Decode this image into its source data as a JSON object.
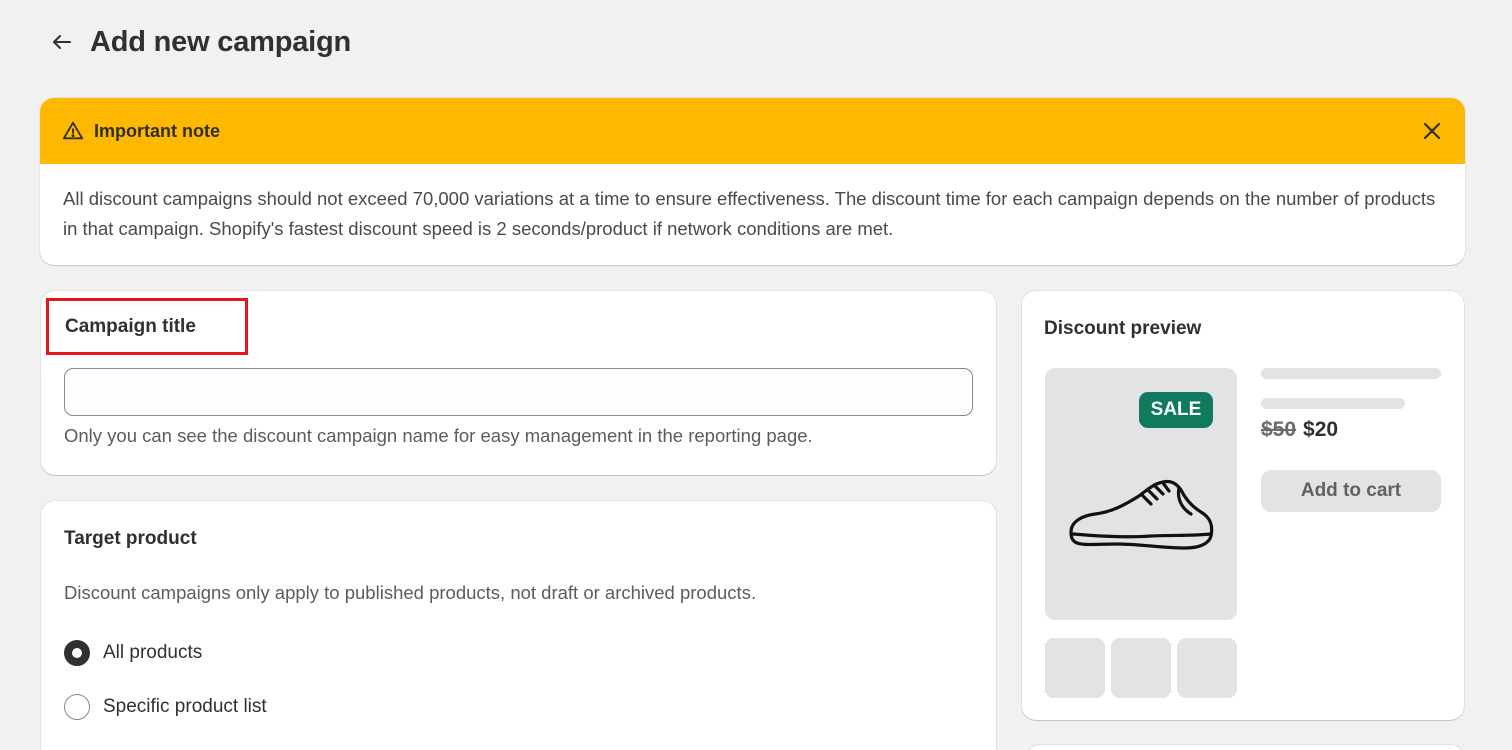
{
  "header": {
    "title": "Add new campaign",
    "back_icon": "arrow-left-icon"
  },
  "banner": {
    "title": "Important note",
    "icon": "warning-icon",
    "close_icon": "close-icon",
    "body": "All discount campaigns should not exceed 70,000 variations at a time to ensure effectiveness. The discount time for each campaign depends on the number of products in that campaign. Shopify's fastest discount speed is 2 seconds/product if network conditions are met.",
    "color": "#ffb800"
  },
  "campaign": {
    "title": "Campaign title",
    "input_value": "",
    "help_text": "Only you can see the discount campaign name for easy management in the reporting page.",
    "highlight_color": "#e8141c"
  },
  "target": {
    "title": "Target product",
    "description": "Discount campaigns only apply to published products, not draft or archived products.",
    "options": [
      {
        "label": "All products",
        "checked": true
      },
      {
        "label": "Specific product list",
        "checked": false
      }
    ]
  },
  "preview": {
    "title": "Discount preview",
    "badge": "SALE",
    "badge_color": "#0f7a5e",
    "product_icon": "sneaker-icon",
    "old_price": "$50",
    "new_price": "$20",
    "add_to_cart": "Add to cart"
  }
}
